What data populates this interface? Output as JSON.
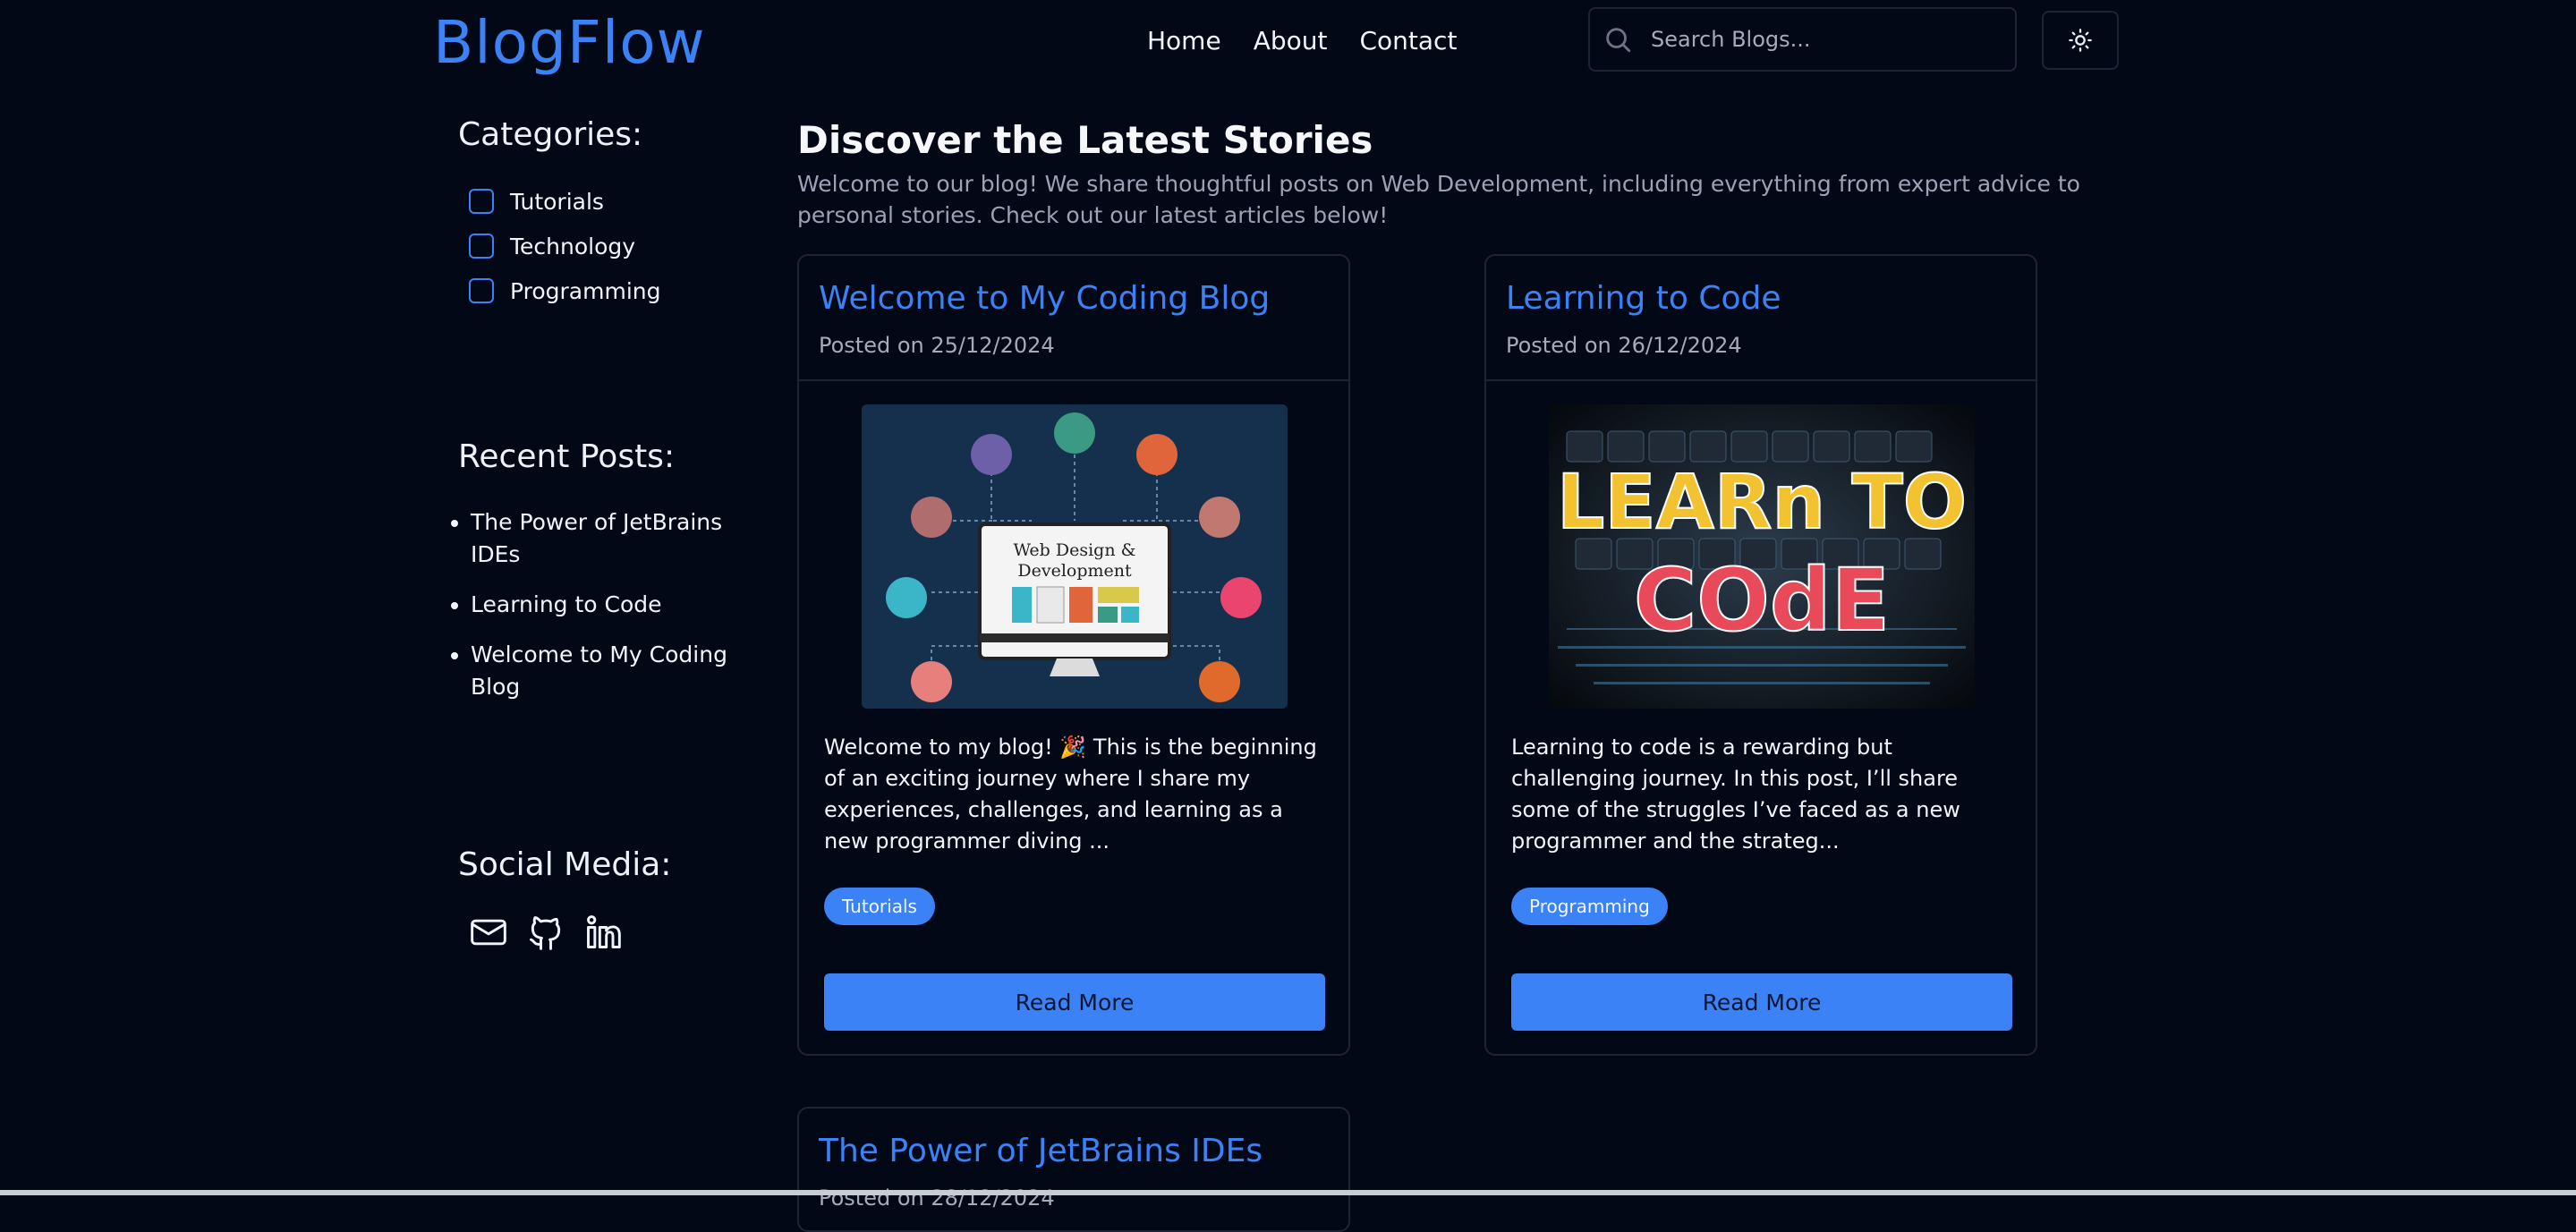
{
  "header": {
    "brand": "BlogFlow",
    "nav": [
      "Home",
      "About",
      "Contact"
    ],
    "search_placeholder": "Search Blogs...",
    "theme_icon": "sun-icon"
  },
  "sidebar": {
    "categories_heading": "Categories:",
    "categories": [
      "Tutorials",
      "Technology",
      "Programming"
    ],
    "recent_heading": "Recent Posts:",
    "recent_posts": [
      "The Power of JetBrains IDEs",
      "Learning to Code",
      "Welcome to My Coding Blog"
    ],
    "social_heading": "Social Media:",
    "social_icons": [
      "mail-icon",
      "github-icon",
      "linkedin-icon"
    ]
  },
  "main": {
    "title": "Discover the Latest Stories",
    "intro": "Welcome to our blog! We share thoughtful posts on Web Development, including everything from expert advice to personal stories. Check out our latest articles below!",
    "posts": [
      {
        "title": "Welcome to My Coding Blog",
        "date": "Posted on 25/12/2024",
        "image_text_1": "Web Design &",
        "image_text_2": "Development",
        "excerpt": "Welcome to my blog! 🎉 This is the beginning of an exciting journey where I share my experiences, challenges, and learning as a new programmer diving ...",
        "tag": "Tutorials",
        "button": "Read More"
      },
      {
        "title": "Learning to Code",
        "date": "Posted on 26/12/2024",
        "image_text_1": "LEARn TO",
        "image_text_2": "COdE",
        "excerpt": "Learning to code is a rewarding but challenging journey. In this post, I’ll share some of the struggles I’ve faced as a new programmer and the strateg...",
        "tag": "Programming",
        "button": "Read More"
      },
      {
        "title": "The Power of JetBrains IDEs",
        "date": "Posted on 28/12/2024"
      }
    ]
  },
  "colors": {
    "background": "#030816",
    "accent": "#3b82f6",
    "border": "#1c2538",
    "muted_text": "#9aa3b5"
  }
}
